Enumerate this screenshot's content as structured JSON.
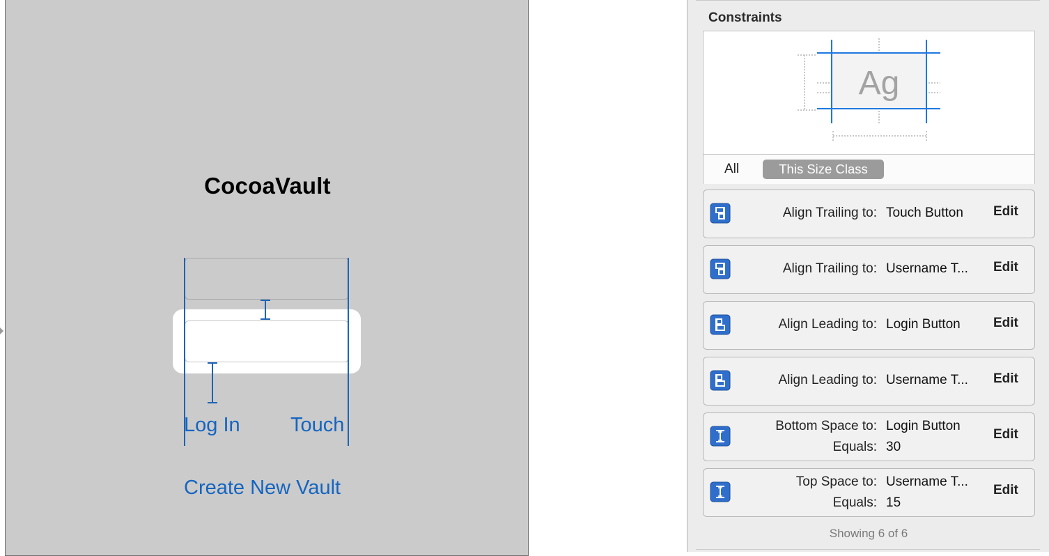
{
  "canvas": {
    "app_title": "CocoaVault",
    "login_label": "Log In",
    "touch_label": "Touch",
    "create_label": "Create New Vault"
  },
  "inspector": {
    "section_title": "Constraints",
    "preview_sample": "Ag",
    "filter_all": "All",
    "filter_size_class": "This Size Class",
    "constraints": [
      {
        "icon": "align-trailing-icon",
        "key1": "Align Trailing to:",
        "val1": "Touch Button",
        "key2": "",
        "val2": "",
        "edit": "Edit"
      },
      {
        "icon": "align-trailing-icon",
        "key1": "Align Trailing to:",
        "val1": "Username T...",
        "key2": "",
        "val2": "",
        "edit": "Edit"
      },
      {
        "icon": "align-leading-icon",
        "key1": "Align Leading to:",
        "val1": "Login Button",
        "key2": "",
        "val2": "",
        "edit": "Edit"
      },
      {
        "icon": "align-leading-icon",
        "key1": "Align Leading to:",
        "val1": "Username T...",
        "key2": "",
        "val2": "",
        "edit": "Edit"
      },
      {
        "icon": "vertical-space-icon",
        "key1": "Bottom Space to:",
        "val1": "Login Button",
        "key2": "Equals:",
        "val2": "30",
        "edit": "Edit"
      },
      {
        "icon": "vertical-space-icon",
        "key1": "Top Space to:",
        "val1": "Username T...",
        "key2": "Equals:",
        "val2": "15",
        "edit": "Edit"
      }
    ],
    "showing": "Showing 6 of 6"
  },
  "colors": {
    "scene_bg": "#cbcbcb",
    "link_blue": "#1565c0",
    "guide_blue": "#1d63b6",
    "icon_blue": "#2f6fcb",
    "inspector_bg": "#ececec"
  }
}
